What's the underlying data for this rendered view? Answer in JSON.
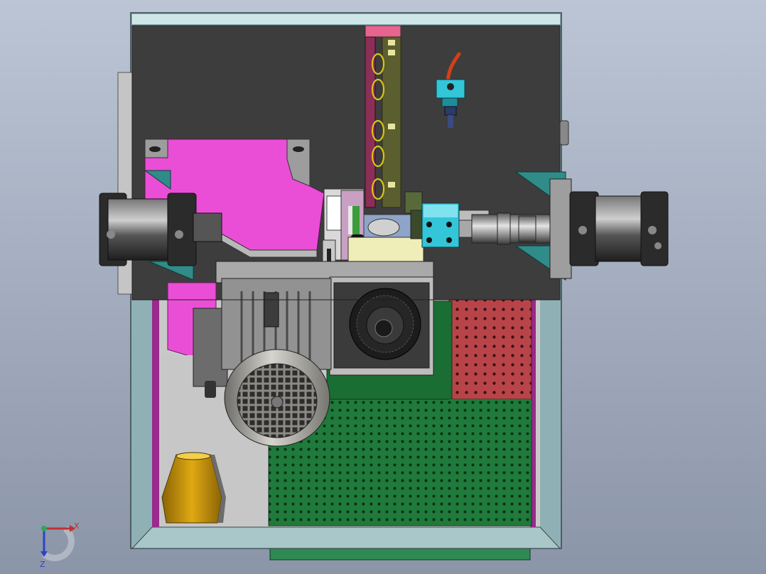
{
  "view": {
    "background_top": "#b9c2d2",
    "background_bottom": "#8d97aa"
  },
  "colors": {
    "housing": "#3d3d3d",
    "frame_teal": "#8fb1b5",
    "panel_magenta": "#ea4ed6",
    "pcb_green": "#1f7a3c",
    "pcb_red": "#b8444a",
    "motor_gray": "#b5b3ad",
    "cylinder_black": "#2b2b2b",
    "valve_cyan": "#33c5d8",
    "hopper_gold": "#c9960c",
    "cream_block": "#efeeb8",
    "spring_yellow": "#d8c21a"
  },
  "triad": {
    "x_label": "X",
    "z_label": "Z"
  }
}
